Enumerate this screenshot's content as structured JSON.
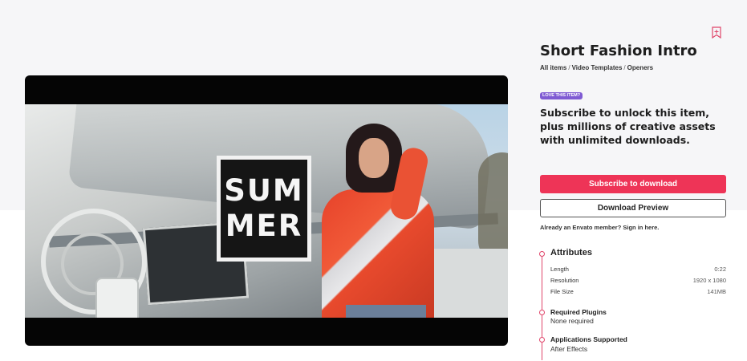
{
  "item": {
    "title": "Short Fashion Intro",
    "breadcrumbs": [
      "All items",
      "Video Templates",
      "Openers"
    ],
    "breadcrumb_separator": "/"
  },
  "preview": {
    "overlay_line1": "SUM",
    "overlay_line2": "MER"
  },
  "promo": {
    "badge": "LOVE THIS ITEM?",
    "pitch": "Subscribe to unlock this item, plus millions of creative assets with unlimited downloads."
  },
  "actions": {
    "subscribe_label": "Subscribe to download",
    "preview_label": "Download Preview",
    "signin_text": "Already an Envato member? Sign in here."
  },
  "attributes": {
    "title": "Attributes",
    "rows": [
      {
        "label": "Length",
        "value": "0:22"
      },
      {
        "label": "Resolution",
        "value": "1920 x 1080"
      },
      {
        "label": "File Size",
        "value": "141MB"
      }
    ]
  },
  "plugins": {
    "title": "Required Plugins",
    "value": "None required"
  },
  "applications": {
    "title": "Applications Supported",
    "value": "After Effects"
  },
  "colors": {
    "accent": "#ee3457",
    "badge": "#7f5bd3",
    "timeline": "#e0456a"
  },
  "icons": {
    "bookmark": "bookmark-icon"
  }
}
